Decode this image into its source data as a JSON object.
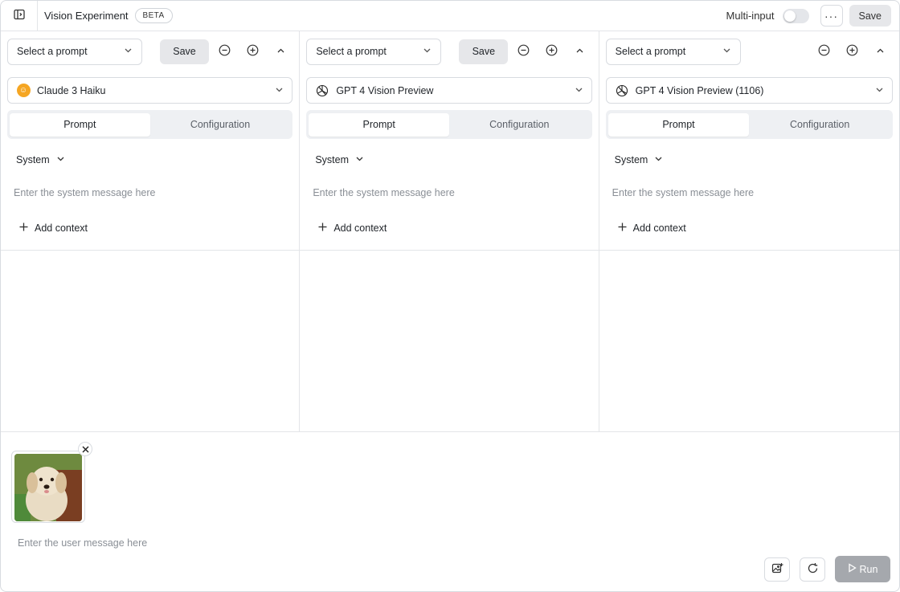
{
  "header": {
    "title": "Vision Experiment",
    "badge": "BETA",
    "multi_input_label": "Multi-input",
    "multi_input_on": false,
    "more_glyph": "···",
    "save_label": "Save"
  },
  "columns": [
    {
      "prompt_placeholder": "Select a prompt",
      "save_label": "Save",
      "model": "Claude 3 Haiku",
      "model_icon": "claude-icon",
      "tabs": [
        "Prompt",
        "Configuration"
      ],
      "active_tab": "Prompt",
      "system_label": "System",
      "system_placeholder": "Enter the system message here",
      "add_context_label": "Add context"
    },
    {
      "prompt_placeholder": "Select a prompt",
      "save_label": "Save",
      "model": "GPT 4 Vision Preview",
      "model_icon": "openai-icon",
      "tabs": [
        "Prompt",
        "Configuration"
      ],
      "active_tab": "Prompt",
      "system_label": "System",
      "system_placeholder": "Enter the system message here",
      "add_context_label": "Add context"
    },
    {
      "prompt_placeholder": "Select a prompt",
      "save_label": "",
      "model": "GPT 4 Vision Preview (1106)",
      "model_icon": "openai-icon",
      "tabs": [
        "Prompt",
        "Configuration"
      ],
      "active_tab": "Prompt",
      "system_label": "System",
      "system_placeholder": "Enter the system message here",
      "add_context_label": "Add context"
    }
  ],
  "input": {
    "attachment": "puppy-photo",
    "user_placeholder": "Enter the user message here",
    "run_label": "Run"
  },
  "colors": {
    "claude_accent": "#f5a623",
    "border": "#d8dbe0",
    "run_disabled": "#a5a8ad"
  }
}
